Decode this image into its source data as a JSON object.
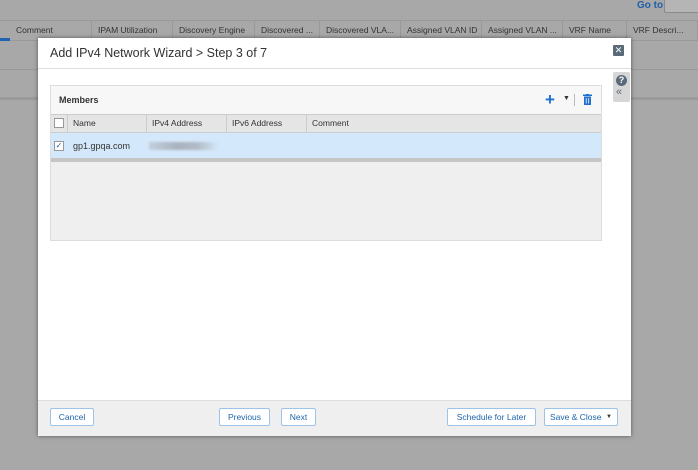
{
  "background": {
    "goto_label": "Go to",
    "columns": [
      "Comment",
      "IPAM Utilization",
      "Discovery Engine",
      "Discovered ...",
      "Discovered VLA...",
      "Assigned VLAN ID",
      "Assigned VLAN ...",
      "VRF Name",
      "VRF Descri..."
    ]
  },
  "dialog": {
    "title": "Add IPv4 Network Wizard > Step 3 of 7",
    "close_icon": "close-icon",
    "help_icon": "?",
    "collapse_icon": "«"
  },
  "members": {
    "title": "Members",
    "add_icon": "+",
    "columns": [
      "Name",
      "IPv4 Address",
      "IPv6 Address",
      "Comment"
    ],
    "rows": [
      {
        "checked": true,
        "name": "gp1.gpqa.com",
        "ipv4": "",
        "ipv6": "",
        "comment": ""
      }
    ]
  },
  "footer": {
    "cancel": "Cancel",
    "previous": "Previous",
    "next": "Next",
    "schedule": "Schedule for Later",
    "save_close": "Save & Close"
  }
}
